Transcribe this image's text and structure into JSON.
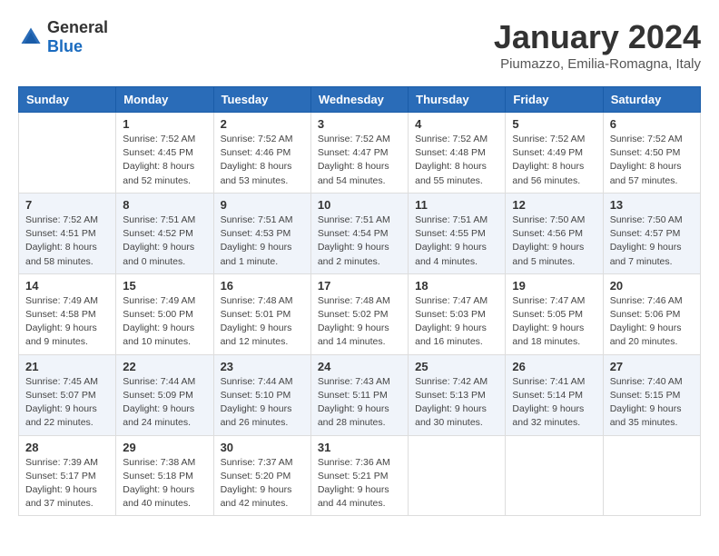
{
  "logo": {
    "general": "General",
    "blue": "Blue"
  },
  "title": "January 2024",
  "location": "Piumazzo, Emilia-Romagna, Italy",
  "days_of_week": [
    "Sunday",
    "Monday",
    "Tuesday",
    "Wednesday",
    "Thursday",
    "Friday",
    "Saturday"
  ],
  "weeks": [
    [
      {
        "day": "",
        "info": ""
      },
      {
        "day": "1",
        "info": "Sunrise: 7:52 AM\nSunset: 4:45 PM\nDaylight: 8 hours\nand 52 minutes."
      },
      {
        "day": "2",
        "info": "Sunrise: 7:52 AM\nSunset: 4:46 PM\nDaylight: 8 hours\nand 53 minutes."
      },
      {
        "day": "3",
        "info": "Sunrise: 7:52 AM\nSunset: 4:47 PM\nDaylight: 8 hours\nand 54 minutes."
      },
      {
        "day": "4",
        "info": "Sunrise: 7:52 AM\nSunset: 4:48 PM\nDaylight: 8 hours\nand 55 minutes."
      },
      {
        "day": "5",
        "info": "Sunrise: 7:52 AM\nSunset: 4:49 PM\nDaylight: 8 hours\nand 56 minutes."
      },
      {
        "day": "6",
        "info": "Sunrise: 7:52 AM\nSunset: 4:50 PM\nDaylight: 8 hours\nand 57 minutes."
      }
    ],
    [
      {
        "day": "7",
        "info": "Sunrise: 7:52 AM\nSunset: 4:51 PM\nDaylight: 8 hours\nand 58 minutes."
      },
      {
        "day": "8",
        "info": "Sunrise: 7:51 AM\nSunset: 4:52 PM\nDaylight: 9 hours\nand 0 minutes."
      },
      {
        "day": "9",
        "info": "Sunrise: 7:51 AM\nSunset: 4:53 PM\nDaylight: 9 hours\nand 1 minute."
      },
      {
        "day": "10",
        "info": "Sunrise: 7:51 AM\nSunset: 4:54 PM\nDaylight: 9 hours\nand 2 minutes."
      },
      {
        "day": "11",
        "info": "Sunrise: 7:51 AM\nSunset: 4:55 PM\nDaylight: 9 hours\nand 4 minutes."
      },
      {
        "day": "12",
        "info": "Sunrise: 7:50 AM\nSunset: 4:56 PM\nDaylight: 9 hours\nand 5 minutes."
      },
      {
        "day": "13",
        "info": "Sunrise: 7:50 AM\nSunset: 4:57 PM\nDaylight: 9 hours\nand 7 minutes."
      }
    ],
    [
      {
        "day": "14",
        "info": "Sunrise: 7:49 AM\nSunset: 4:58 PM\nDaylight: 9 hours\nand 9 minutes."
      },
      {
        "day": "15",
        "info": "Sunrise: 7:49 AM\nSunset: 5:00 PM\nDaylight: 9 hours\nand 10 minutes."
      },
      {
        "day": "16",
        "info": "Sunrise: 7:48 AM\nSunset: 5:01 PM\nDaylight: 9 hours\nand 12 minutes."
      },
      {
        "day": "17",
        "info": "Sunrise: 7:48 AM\nSunset: 5:02 PM\nDaylight: 9 hours\nand 14 minutes."
      },
      {
        "day": "18",
        "info": "Sunrise: 7:47 AM\nSunset: 5:03 PM\nDaylight: 9 hours\nand 16 minutes."
      },
      {
        "day": "19",
        "info": "Sunrise: 7:47 AM\nSunset: 5:05 PM\nDaylight: 9 hours\nand 18 minutes."
      },
      {
        "day": "20",
        "info": "Sunrise: 7:46 AM\nSunset: 5:06 PM\nDaylight: 9 hours\nand 20 minutes."
      }
    ],
    [
      {
        "day": "21",
        "info": "Sunrise: 7:45 AM\nSunset: 5:07 PM\nDaylight: 9 hours\nand 22 minutes."
      },
      {
        "day": "22",
        "info": "Sunrise: 7:44 AM\nSunset: 5:09 PM\nDaylight: 9 hours\nand 24 minutes."
      },
      {
        "day": "23",
        "info": "Sunrise: 7:44 AM\nSunset: 5:10 PM\nDaylight: 9 hours\nand 26 minutes."
      },
      {
        "day": "24",
        "info": "Sunrise: 7:43 AM\nSunset: 5:11 PM\nDaylight: 9 hours\nand 28 minutes."
      },
      {
        "day": "25",
        "info": "Sunrise: 7:42 AM\nSunset: 5:13 PM\nDaylight: 9 hours\nand 30 minutes."
      },
      {
        "day": "26",
        "info": "Sunrise: 7:41 AM\nSunset: 5:14 PM\nDaylight: 9 hours\nand 32 minutes."
      },
      {
        "day": "27",
        "info": "Sunrise: 7:40 AM\nSunset: 5:15 PM\nDaylight: 9 hours\nand 35 minutes."
      }
    ],
    [
      {
        "day": "28",
        "info": "Sunrise: 7:39 AM\nSunset: 5:17 PM\nDaylight: 9 hours\nand 37 minutes."
      },
      {
        "day": "29",
        "info": "Sunrise: 7:38 AM\nSunset: 5:18 PM\nDaylight: 9 hours\nand 40 minutes."
      },
      {
        "day": "30",
        "info": "Sunrise: 7:37 AM\nSunset: 5:20 PM\nDaylight: 9 hours\nand 42 minutes."
      },
      {
        "day": "31",
        "info": "Sunrise: 7:36 AM\nSunset: 5:21 PM\nDaylight: 9 hours\nand 44 minutes."
      },
      {
        "day": "",
        "info": ""
      },
      {
        "day": "",
        "info": ""
      },
      {
        "day": "",
        "info": ""
      }
    ]
  ]
}
